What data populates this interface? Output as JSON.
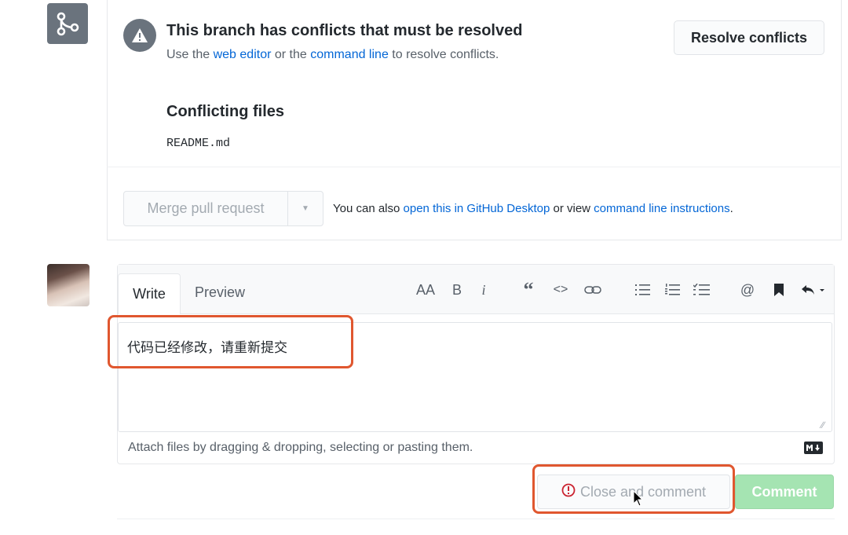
{
  "merge_status": {
    "title": "This branch has conflicts that must be resolved",
    "subtitle_prefix": "Use the ",
    "subtitle_link1": "web editor",
    "subtitle_middle": " or the ",
    "subtitle_link2": "command line",
    "subtitle_suffix": " to resolve conflicts.",
    "resolve_button": "Resolve conflicts",
    "conflicting_title": "Conflicting files",
    "conflicting_files": [
      "README.md"
    ]
  },
  "merge_actions": {
    "merge_button": "Merge pull request",
    "also_prefix": "You can also ",
    "also_link1": "open this in GitHub Desktop",
    "also_middle": " or view ",
    "also_link2": "command line instructions",
    "also_suffix": "."
  },
  "comment": {
    "tabs": {
      "write": "Write",
      "preview": "Preview"
    },
    "toolbar": {
      "heading": "AA",
      "bold": "B",
      "italic": "i",
      "quote": "“",
      "code": "<>",
      "at": "@"
    },
    "text": "代码已经修改，请重新提交",
    "attach_hint": "Attach files by dragging & dropping, selecting or pasting them.",
    "close_button": "Close and comment",
    "comment_button": "Comment"
  },
  "colors": {
    "link": "#0366d6",
    "highlight": "#e0572f",
    "comment_button_disabled": "#a5e4b2"
  }
}
